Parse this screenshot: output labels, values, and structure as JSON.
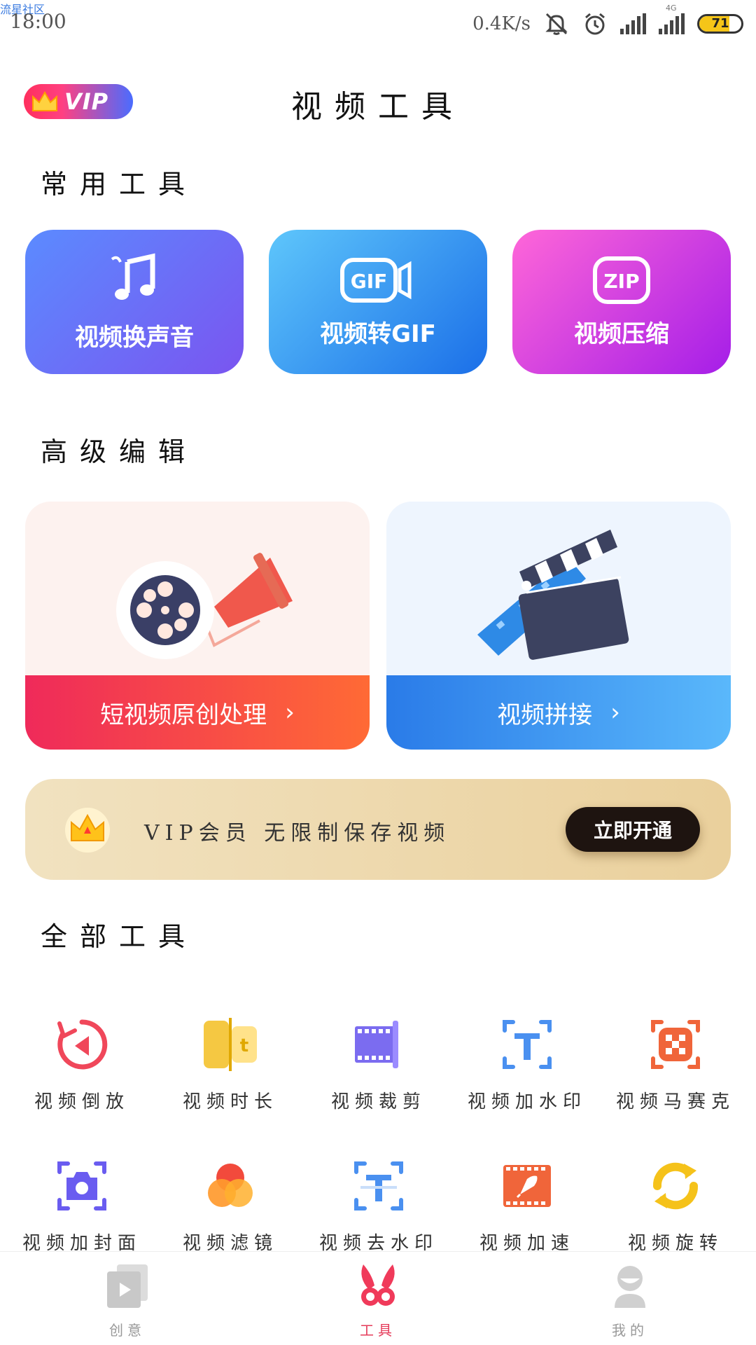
{
  "status_bar": {
    "watermark": "流星社区",
    "time": "18:00",
    "speed": "0.4K/s",
    "network": "4G",
    "battery": "71",
    "battery_level": 0.71
  },
  "header": {
    "vip_badge": "VIP",
    "title": "视频工具"
  },
  "common_tools": {
    "title": "常用工具",
    "items": [
      {
        "label": "视频换声音",
        "icon": "music-note-icon"
      },
      {
        "label": "视频转GIF",
        "icon": "gif-icon"
      },
      {
        "label": "视频压缩",
        "icon": "zip-icon"
      }
    ]
  },
  "advanced": {
    "title": "高级编辑",
    "cards": [
      {
        "label": "短视频原创处理",
        "icon": "film-reel-megaphone-icon"
      },
      {
        "label": "视频拼接",
        "icon": "clapperboard-icon"
      }
    ]
  },
  "vip_banner": {
    "text": "VIP会员 无限制保存视频",
    "button": "立即开通"
  },
  "all_tools": {
    "title": "全部工具",
    "items": [
      {
        "label": "视频倒放",
        "icon": "reverse-icon"
      },
      {
        "label": "视频时长",
        "icon": "duration-icon"
      },
      {
        "label": "视频裁剪",
        "icon": "crop-icon"
      },
      {
        "label": "视频加水印",
        "icon": "add-watermark-icon"
      },
      {
        "label": "视频马赛克",
        "icon": "mosaic-icon"
      },
      {
        "label": "视频加封面",
        "icon": "cover-camera-icon"
      },
      {
        "label": "视频滤镜",
        "icon": "filter-icon"
      },
      {
        "label": "视频去水印",
        "icon": "remove-watermark-icon"
      },
      {
        "label": "视频加速",
        "icon": "speed-rocket-icon"
      },
      {
        "label": "视频旋转",
        "icon": "rotate-icon"
      }
    ]
  },
  "bottom_nav": {
    "items": [
      {
        "label": "创意",
        "icon": "creative-play-icon",
        "active": false
      },
      {
        "label": "工具",
        "icon": "tools-rabbit-icon",
        "active": true
      },
      {
        "label": "我的",
        "icon": "profile-icon",
        "active": false
      }
    ]
  },
  "colors": {
    "accent_red": "#ef2a5a",
    "accent_blue": "#2a7be8",
    "vip_gold": "#ead09c",
    "nav_active": "#e53b5a"
  }
}
